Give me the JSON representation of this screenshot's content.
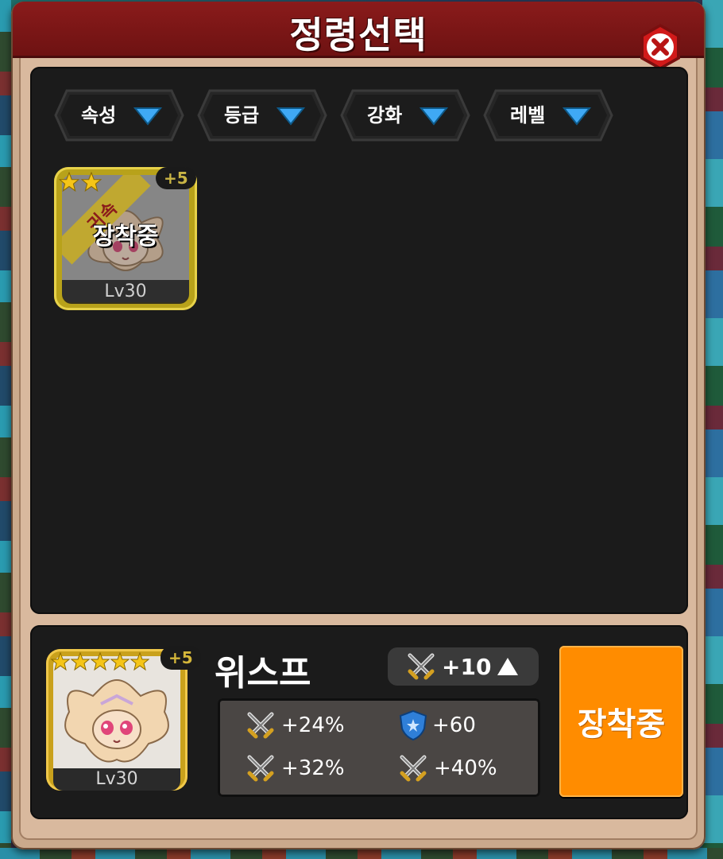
{
  "dialog": {
    "title": "정령선택"
  },
  "filters": [
    {
      "label": "속성",
      "icon": "dropdown-triangle-icon"
    },
    {
      "label": "등급",
      "icon": "dropdown-triangle-icon"
    },
    {
      "label": "강화",
      "icon": "dropdown-triangle-icon"
    },
    {
      "label": "레벨",
      "icon": "dropdown-triangle-icon"
    }
  ],
  "grid": {
    "items": [
      {
        "stars": 2,
        "enhance": "+5",
        "ribbon": "귀속",
        "status": "장착중",
        "level": "Lv30"
      }
    ]
  },
  "detail": {
    "name": "위스프",
    "stars": 5,
    "enhance": "+5",
    "level": "Lv30",
    "upgrade": "+10",
    "stats": [
      {
        "icon": "crossed-swords-icon",
        "value": "+24%"
      },
      {
        "icon": "shield-icon",
        "value": "+60"
      },
      {
        "icon": "crossed-swords-icon",
        "value": "+32%"
      },
      {
        "icon": "crossed-swords-icon",
        "value": "+40%"
      }
    ],
    "equip_button": "장착중"
  },
  "colors": {
    "title_bar": "#8a1b1b",
    "panel": "#1b1b1b",
    "frame_tan": "#caa98c",
    "equip_orange": "#ff8c00",
    "arrow_blue": "#3fa9f5",
    "gold": "#c9a11c"
  }
}
